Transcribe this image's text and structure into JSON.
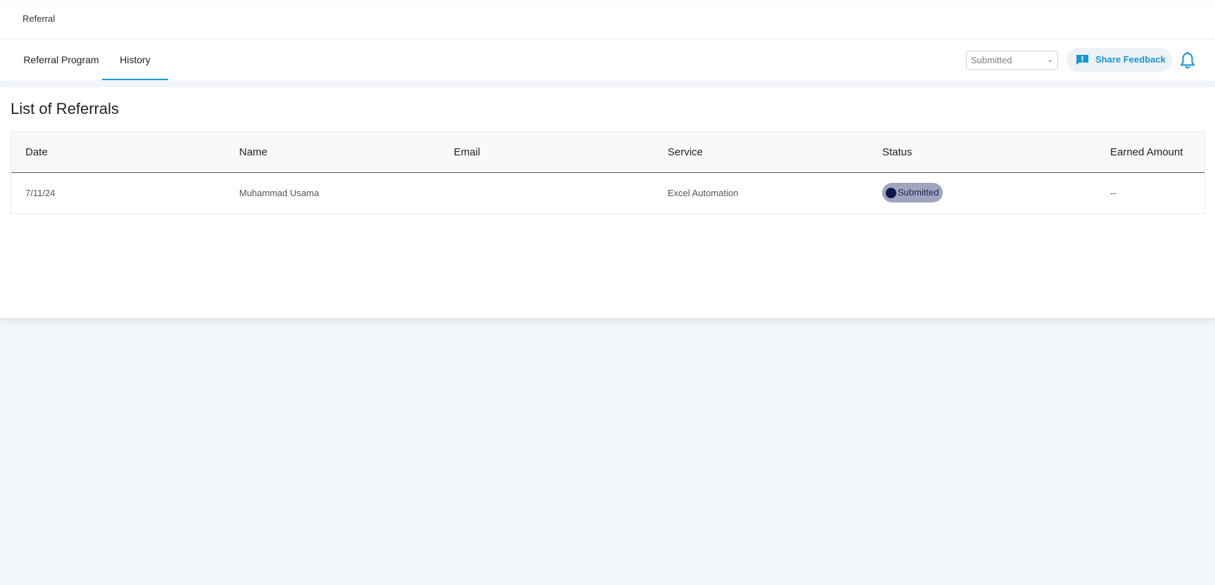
{
  "header": {
    "breadcrumb": "Referral"
  },
  "nav": {
    "tabs": [
      {
        "label": "Referral Program",
        "active": false
      },
      {
        "label": "History",
        "active": true
      }
    ],
    "status_filter": {
      "selected": "Submitted"
    },
    "share_feedback_label": "Share Feedback",
    "icons": {
      "feedback": "feedback-alert-icon",
      "notifications": "bell-icon",
      "dropdown": "chevron-down-icon"
    }
  },
  "main": {
    "title": "List of Referrals",
    "table": {
      "columns": [
        "Date",
        "Name",
        "Email",
        "Service",
        "Status",
        "Earned Amount"
      ],
      "rows": [
        {
          "date": "7/11/24",
          "name": "Muhammad Usama",
          "email": "",
          "service": "Excel Automation",
          "status": "Submitted",
          "earned_amount": "--"
        }
      ]
    }
  },
  "colors": {
    "accent": "#1596d0",
    "tab_underline": "#1aa0dc",
    "badge_bg": "#9ea6bd",
    "badge_dot": "#0c1a4a",
    "page_bg": "#f3f6f9"
  }
}
